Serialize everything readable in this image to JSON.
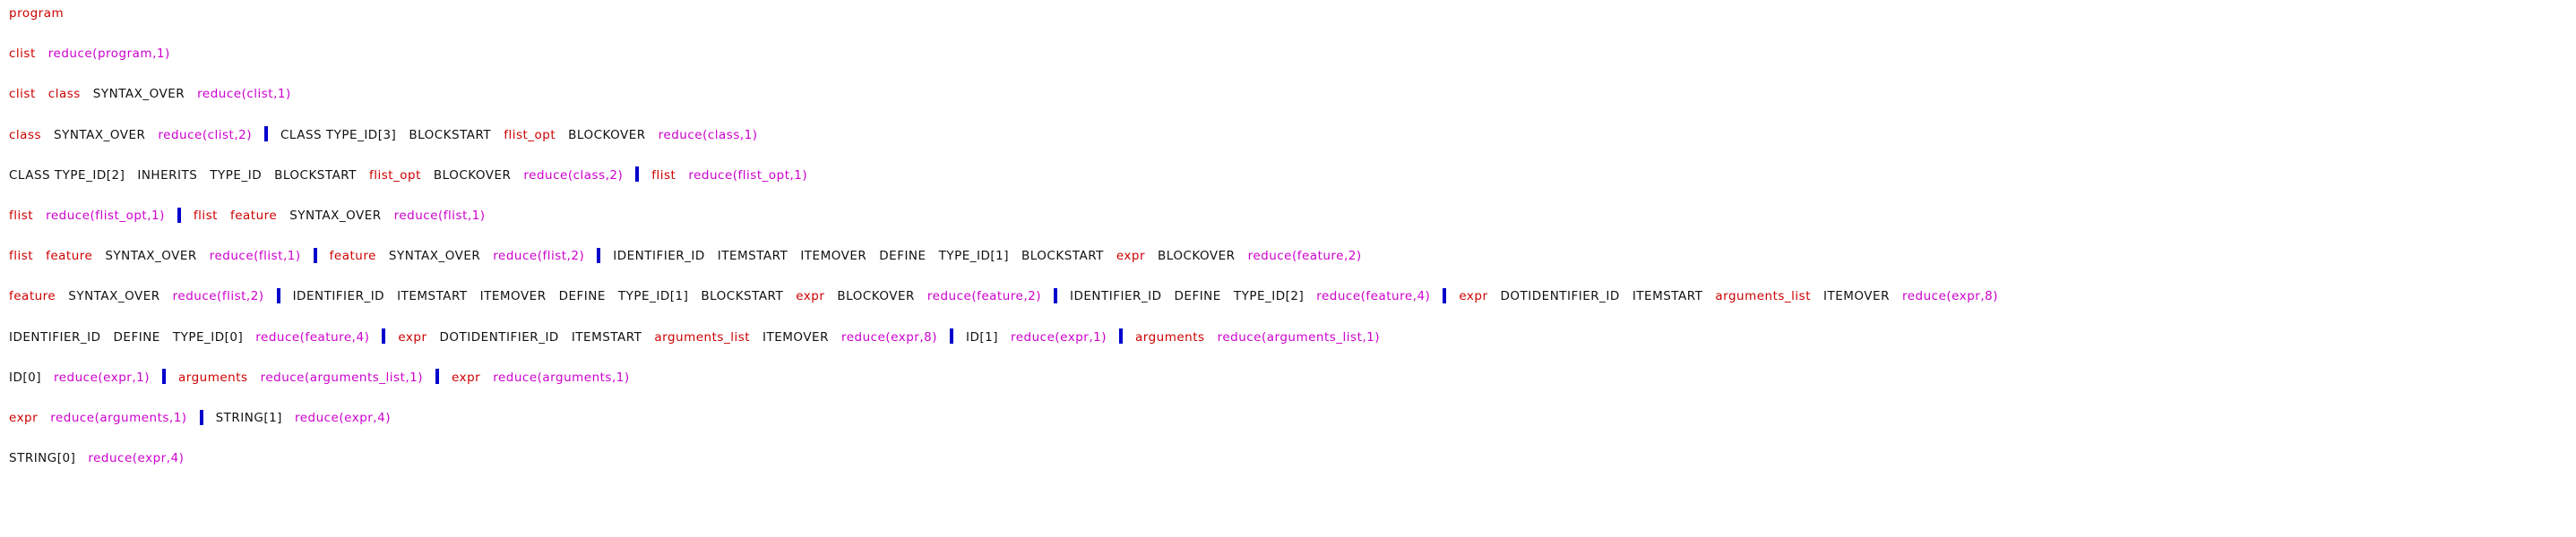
{
  "colors": {
    "terminal": "#111111",
    "nonterminal": "#cc0000",
    "reduce": "#cc00cc",
    "separator": "#0000cc"
  },
  "lines": [
    [
      {
        "t": "program",
        "c": "red"
      }
    ],
    [
      {
        "t": "clist",
        "c": "red"
      },
      {
        "t": "reduce(program,1)",
        "c": "magenta"
      }
    ],
    [
      {
        "t": "clist",
        "c": "red"
      },
      {
        "t": "class",
        "c": "red"
      },
      {
        "t": "SYNTAX_OVER",
        "c": "black"
      },
      {
        "t": "reduce(clist,1)",
        "c": "magenta"
      }
    ],
    [
      {
        "t": "class",
        "c": "red"
      },
      {
        "t": "SYNTAX_OVER",
        "c": "black"
      },
      {
        "t": "reduce(clist,2)",
        "c": "magenta"
      },
      {
        "sep": true
      },
      {
        "t": "CLASS TYPE_ID[3]",
        "c": "black"
      },
      {
        "t": "BLOCKSTART",
        "c": "black"
      },
      {
        "t": "flist_opt",
        "c": "red"
      },
      {
        "t": "BLOCKOVER",
        "c": "black"
      },
      {
        "t": "reduce(class,1)",
        "c": "magenta"
      }
    ],
    [
      {
        "t": "CLASS TYPE_ID[2]",
        "c": "black"
      },
      {
        "t": "INHERITS",
        "c": "black"
      },
      {
        "t": "TYPE_ID",
        "c": "black"
      },
      {
        "t": "BLOCKSTART",
        "c": "black"
      },
      {
        "t": "flist_opt",
        "c": "red"
      },
      {
        "t": "BLOCKOVER",
        "c": "black"
      },
      {
        "t": "reduce(class,2)",
        "c": "magenta"
      },
      {
        "sep": true
      },
      {
        "t": "flist",
        "c": "red"
      },
      {
        "t": "reduce(flist_opt,1)",
        "c": "magenta"
      }
    ],
    [
      {
        "t": "flist",
        "c": "red"
      },
      {
        "t": "reduce(flist_opt,1)",
        "c": "magenta"
      },
      {
        "sep": true
      },
      {
        "t": "flist",
        "c": "red"
      },
      {
        "t": "feature",
        "c": "red"
      },
      {
        "t": "SYNTAX_OVER",
        "c": "black"
      },
      {
        "t": "reduce(flist,1)",
        "c": "magenta"
      }
    ],
    [
      {
        "t": "flist",
        "c": "red"
      },
      {
        "t": "feature",
        "c": "red"
      },
      {
        "t": "SYNTAX_OVER",
        "c": "black"
      },
      {
        "t": "reduce(flist,1)",
        "c": "magenta"
      },
      {
        "sep": true
      },
      {
        "t": "feature",
        "c": "red"
      },
      {
        "t": "SYNTAX_OVER",
        "c": "black"
      },
      {
        "t": "reduce(flist,2)",
        "c": "magenta"
      },
      {
        "sep": true
      },
      {
        "t": "IDENTIFIER_ID",
        "c": "black"
      },
      {
        "t": "ITEMSTART",
        "c": "black"
      },
      {
        "t": "ITEMOVER",
        "c": "black"
      },
      {
        "t": "DEFINE",
        "c": "black"
      },
      {
        "t": "TYPE_ID[1]",
        "c": "black"
      },
      {
        "t": "BLOCKSTART",
        "c": "black"
      },
      {
        "t": "expr",
        "c": "red"
      },
      {
        "t": "BLOCKOVER",
        "c": "black"
      },
      {
        "t": "reduce(feature,2)",
        "c": "magenta"
      }
    ],
    [
      {
        "t": "feature",
        "c": "red"
      },
      {
        "t": "SYNTAX_OVER",
        "c": "black"
      },
      {
        "t": "reduce(flist,2)",
        "c": "magenta"
      },
      {
        "sep": true
      },
      {
        "t": "IDENTIFIER_ID",
        "c": "black"
      },
      {
        "t": "ITEMSTART",
        "c": "black"
      },
      {
        "t": "ITEMOVER",
        "c": "black"
      },
      {
        "t": "DEFINE",
        "c": "black"
      },
      {
        "t": "TYPE_ID[1]",
        "c": "black"
      },
      {
        "t": "BLOCKSTART",
        "c": "black"
      },
      {
        "t": "expr",
        "c": "red"
      },
      {
        "t": "BLOCKOVER",
        "c": "black"
      },
      {
        "t": "reduce(feature,2)",
        "c": "magenta"
      },
      {
        "sep": true
      },
      {
        "t": "IDENTIFIER_ID",
        "c": "black"
      },
      {
        "t": "DEFINE",
        "c": "black"
      },
      {
        "t": "TYPE_ID[2]",
        "c": "black"
      },
      {
        "t": "reduce(feature,4)",
        "c": "magenta"
      },
      {
        "sep": true
      },
      {
        "t": "expr",
        "c": "red"
      },
      {
        "t": "DOTIDENTIFIER_ID",
        "c": "black"
      },
      {
        "t": "ITEMSTART",
        "c": "black"
      },
      {
        "t": "arguments_list",
        "c": "red"
      },
      {
        "t": "ITEMOVER",
        "c": "black"
      },
      {
        "t": "reduce(expr,8)",
        "c": "magenta"
      }
    ],
    [
      {
        "t": "IDENTIFIER_ID",
        "c": "black"
      },
      {
        "t": "DEFINE",
        "c": "black"
      },
      {
        "t": "TYPE_ID[0]",
        "c": "black"
      },
      {
        "t": "reduce(feature,4)",
        "c": "magenta"
      },
      {
        "sep": true
      },
      {
        "t": "expr",
        "c": "red"
      },
      {
        "t": "DOTIDENTIFIER_ID",
        "c": "black"
      },
      {
        "t": "ITEMSTART",
        "c": "black"
      },
      {
        "t": "arguments_list",
        "c": "red"
      },
      {
        "t": "ITEMOVER",
        "c": "black"
      },
      {
        "t": "reduce(expr,8)",
        "c": "magenta"
      },
      {
        "sep": true
      },
      {
        "t": "ID[1]",
        "c": "black"
      },
      {
        "t": "reduce(expr,1)",
        "c": "magenta"
      },
      {
        "sep": true
      },
      {
        "t": "arguments",
        "c": "red"
      },
      {
        "t": "reduce(arguments_list,1)",
        "c": "magenta"
      }
    ],
    [
      {
        "t": "ID[0]",
        "c": "black"
      },
      {
        "t": "reduce(expr,1)",
        "c": "magenta"
      },
      {
        "sep": true
      },
      {
        "t": "arguments",
        "c": "red"
      },
      {
        "t": "reduce(arguments_list,1)",
        "c": "magenta"
      },
      {
        "sep": true
      },
      {
        "t": "expr",
        "c": "red"
      },
      {
        "t": "reduce(arguments,1)",
        "c": "magenta"
      }
    ],
    [
      {
        "t": "expr",
        "c": "red"
      },
      {
        "t": "reduce(arguments,1)",
        "c": "magenta"
      },
      {
        "sep": true
      },
      {
        "t": "STRING[1]",
        "c": "black"
      },
      {
        "t": "reduce(expr,4)",
        "c": "magenta"
      }
    ],
    [
      {
        "t": "STRING[0]",
        "c": "black"
      },
      {
        "t": "reduce(expr,4)",
        "c": "magenta"
      }
    ]
  ]
}
